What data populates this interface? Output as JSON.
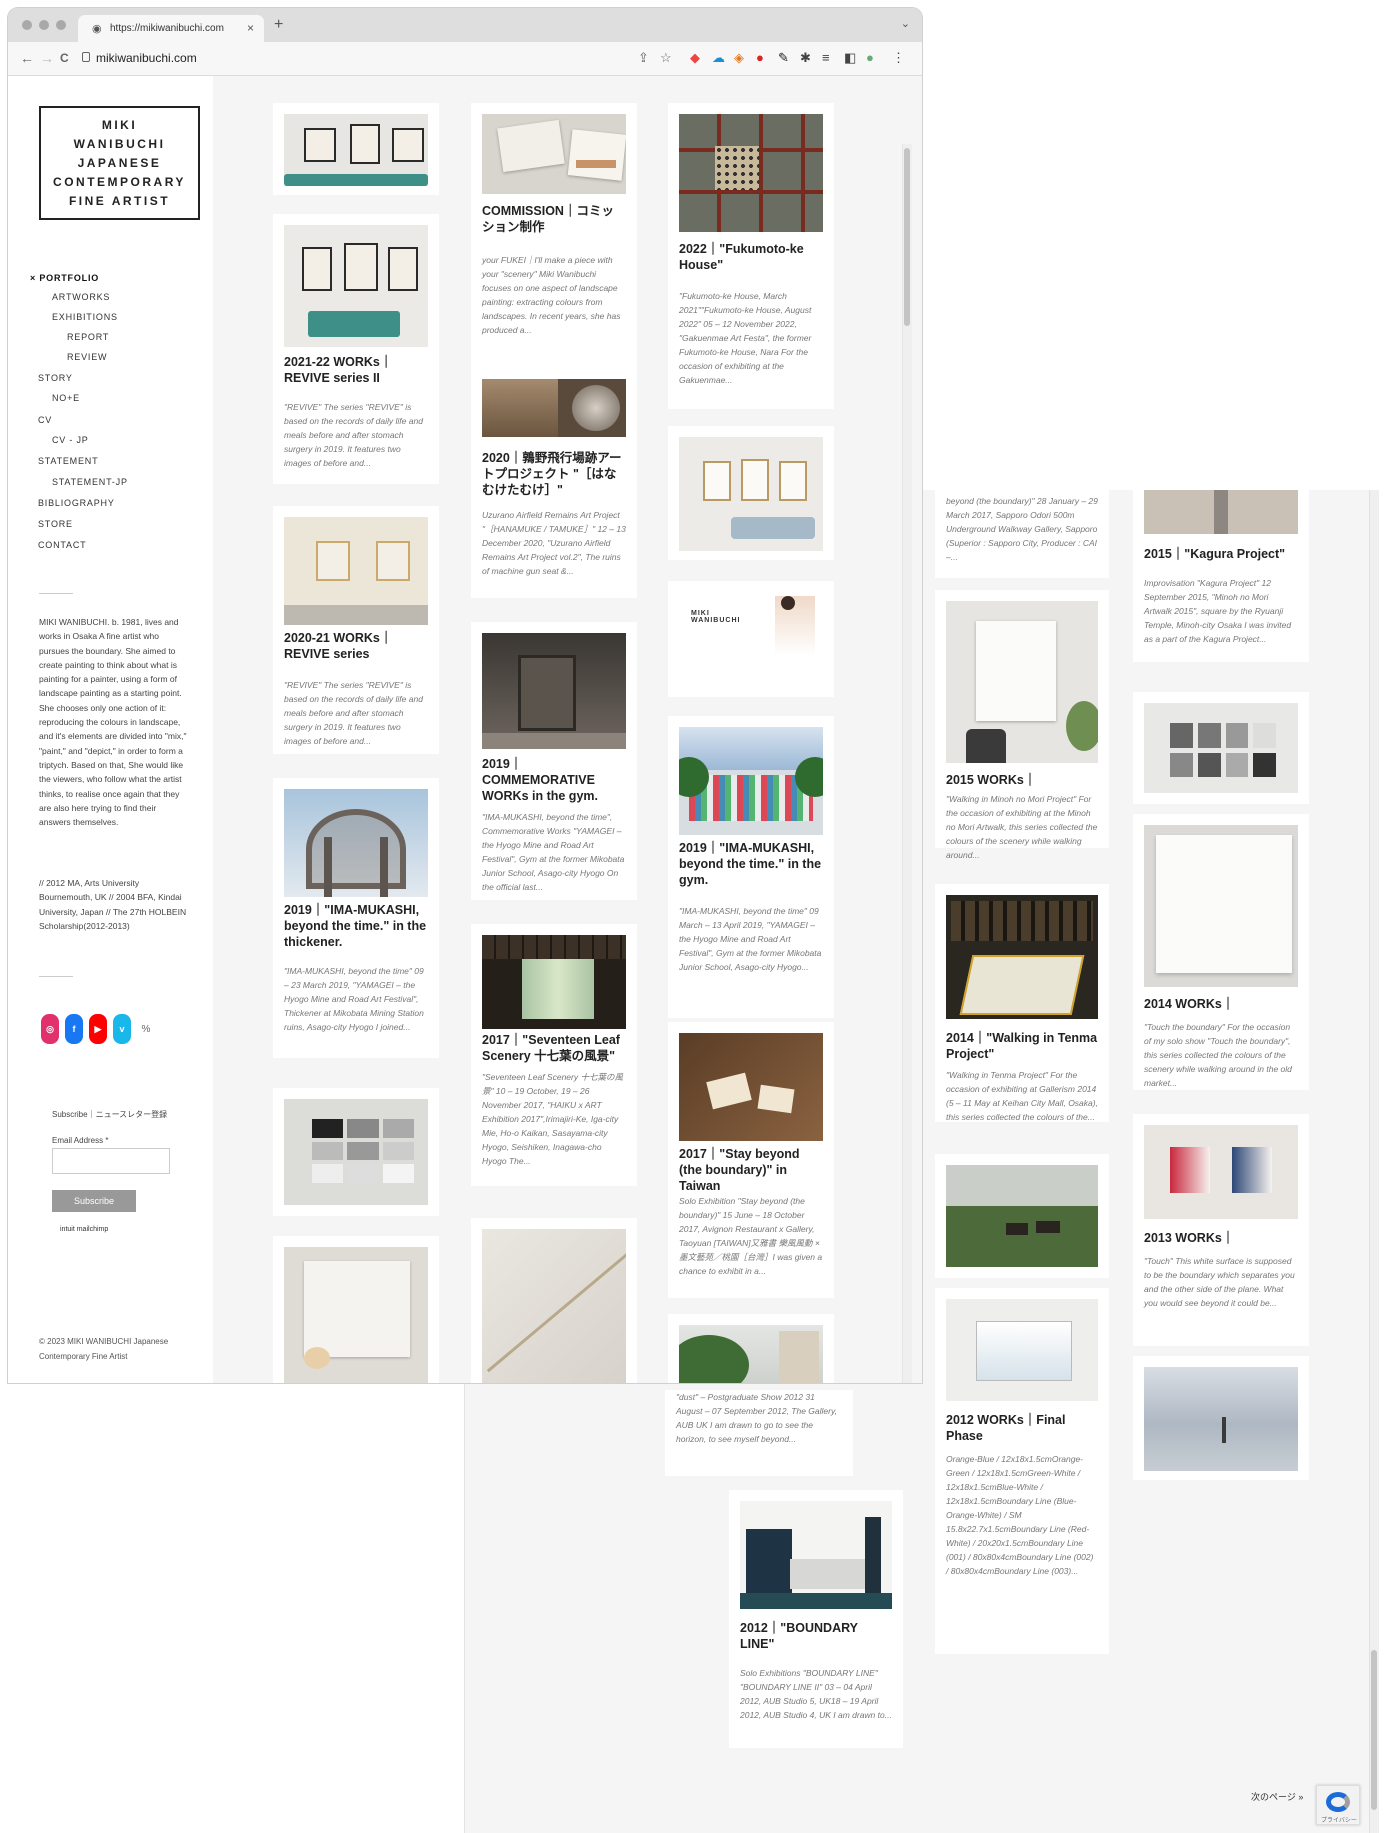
{
  "browser": {
    "tab_title": "https://mikiwanibuchi.com",
    "url": "mikiwanibuchi.com",
    "tab_close": "×",
    "new_tab": "+",
    "back": "←",
    "forward": "→",
    "reload": "C",
    "menu": "⋮"
  },
  "logo": {
    "line1": "MIKI",
    "line2": "WANIBUCHI",
    "line3": "JAPANESE",
    "line4": "CONTEMPORARY",
    "line5": "FINE ARTIST"
  },
  "menu": {
    "items": [
      "× PORTFOLIO",
      "ARTWORKS",
      "EXHIBITIONS",
      "REPORT",
      "REVIEW",
      "STORY",
      "NO+E",
      "CV",
      "CV - JP",
      "STATEMENT",
      "STATEMENT-JP",
      "BIBLIOGRAPHY",
      "STORE",
      "CONTACT"
    ]
  },
  "bio": {
    "text": "MIKI WANIBUCHI. b. 1981, lives and works in Osaka A fine artist who pursues the boundary. She aimed to create painting to think about what is painting for a painter, using a form of landscape painting as a starting point. She chooses only one action of it: reproducing the colours in landscape, and it's elements are divided into \"mix,\" \"paint,\" and \"depict,\" in order to form a triptych. Based on that, She would like the viewers, who follow what the artist thinks, to realise once again that they are also here trying to find their answers themselves.",
    "cv": "// 2012 MA, Arts University Bournemouth, UK // 2004 BFA, Kindai University, Japan // The 27th HOLBEIN Scholarship(2012-2013)"
  },
  "social": {
    "instagram": "◎",
    "facebook": "f",
    "youtube": "▶",
    "vimeo": "v",
    "link": "%"
  },
  "subscribe": {
    "label": "Subscribe｜ニュースレター登録",
    "email_label": "Email Address *",
    "email_value": "",
    "button": "Subscribe",
    "mailchimp": "intuit mailchimp"
  },
  "footer": {
    "copyright": "© 2023 MIKI WANIBUCHI Japanese Contemporary Fine Artist"
  },
  "cards": [
    {
      "title": "",
      "excerpt": ""
    },
    {
      "title": "2021-22 WORKs｜REVIVE series II",
      "excerpt": "\"REVIVE\" The series \"REVIVE\" is based on the records of daily life and meals before and after stomach surgery in 2019. It features two images of before and..."
    },
    {
      "title": "2020-21 WORKs｜REVIVE series",
      "excerpt": "\"REVIVE\" The series \"REVIVE\" is based on the records of daily life and meals before and after stomach surgery in 2019. It features two images of before and..."
    },
    {
      "title": "2019｜\"IMA-MUKASHI, beyond the time.\" in the thickener.",
      "excerpt": "\"IMA-MUKASHI, beyond the time\" 09 – 23 March 2019, \"YAMAGEI – the Hyogo Mine and Road Art Festival\", Thickener at Mikobata Mining Station ruins, Asago-city Hyogo I joined..."
    },
    {
      "title": "",
      "excerpt": ""
    },
    {
      "title": "",
      "excerpt": ""
    },
    {
      "title": "COMMISSION｜コミッション制作",
      "excerpt": "your FUKEI｜I'll make a piece with your \"scenery\" Miki Wanibuchi focuses on one aspect of landscape painting: extracting colours from landscapes. In recent years, she has produced a..."
    },
    {
      "title": "2020｜鶉野飛行場跡アートプロジェクト \"［はなむけたむけ］\"",
      "excerpt": "Uzurano Airfield Remains Art Project \"［HANAMUKE / TAMUKE］\" 12 – 13 December 2020, \"Uzurano Airfield Remains Art Project vol.2\", The ruins of machine gun seat &..."
    },
    {
      "title": "2019｜COMMEMORATIVE WORKs in the gym.",
      "excerpt": "\"IMA-MUKASHI, beyond the time\", Commemorative Works \"YAMAGEI – the Hyogo Mine and Road Art Festival\", Gym at the former Mikobata Junior School, Asago-city Hyogo On the official last..."
    },
    {
      "title": "2017｜\"Seventeen Leaf Scenery 十七葉の風景\"",
      "excerpt": "\"Seventeen Leaf Scenery 十七葉の風景\" 10 – 19 October, 19 – 26 November 2017, \"HAIKU x ART Exhibition 2017\",Irimajiri-Ke, Iga-city Mie, Ho-o Kaikan, Sasayama-city Hyogo, Seishiken, Inagawa-cho Hyogo The..."
    },
    {
      "title": "",
      "excerpt": ""
    },
    {
      "title": "2022｜\"Fukumoto-ke House\"",
      "excerpt": "\"Fukumoto-ke House, March 2021\"\"Fukumoto-ke House, August 2022\" 05 – 12 November 2022, \"Gakuenmae Art Festa\", the former Fukumoto-ke House, Nara For the occasion of exhibiting at the Gakuenmae..."
    },
    {
      "title": "",
      "excerpt": ""
    },
    {
      "title": "",
      "excerpt": ""
    },
    {
      "title": "2019｜\"IMA-MUKASHI, beyond the time.\" in the gym.",
      "excerpt": "\"IMA-MUKASHI, beyond the time\" 09 March – 13 April 2019, \"YAMAGEI – the Hyogo Mine and Road Art Festival\", Gym at the former Mikobata Junior School, Asago-city Hyogo..."
    },
    {
      "title": "2017｜\"Stay beyond (the boundary)\" in Taiwan",
      "excerpt": "Solo Exhibition \"Stay beyond (the boundary)\" 15 June – 18 October 2017, Avignon Restaurant x Gallery, Taoyuan [TAIWAN]又雅書 樂風風動 ×墨文藝苑／桃園［台灣］I was given a chance to exhibit in a..."
    },
    {
      "title": "",
      "excerpt": ""
    }
  ],
  "back_cards": [
    {
      "title": "",
      "excerpt": "\"dust\" – Postgraduate Show 2012 31 August – 07 September 2012, The Gallery, AUB UK I am drawn to go to see the horizon, to see myself beyond..."
    },
    {
      "title": "2012｜\"BOUNDARY LINE\"",
      "excerpt": "Solo Exhibitions \"BOUNDARY LINE\" \"BOUNDARY LINE II\" 03 – 04 April 2012, AUB Studio 5, UK18 – 19 April 2012, AUB Studio 4, UK I am drawn to..."
    },
    {
      "title": "",
      "excerpt": "beyond (the boundary)\" 28 January – 29 March 2017, Sapporo Odori 500m Underground Walkway Gallery, Sapporo (Superior : Sapporo City, Producer : CAI –..."
    },
    {
      "title": "2015 WORKs｜",
      "excerpt": "\"Walking in Minoh no Mori Project\" For the occasion of exhibiting at the Minoh no Mori Artwalk, this series collected the colours of the scenery while walking around..."
    },
    {
      "title": "2014｜\"Walking in Tenma Project\"",
      "excerpt": "\"Walking in Tenma Project\" For the occasion of exhibiting at Gallerism 2014 (5 – 11 May at Keihan City Mall, Osaka), this series collected the colours of the..."
    },
    {
      "title": "",
      "excerpt": ""
    },
    {
      "title": "2012 WORKs｜Final Phase",
      "excerpt": "Orange-Blue / 12x18x1.5cmOrange-Green / 12x18x1.5cmGreen-White / 12x18x1.5cmBlue-White / 12x18x1.5cmBoundary Line (Blue-Orange-White) / SM 15.8x22.7x1.5cmBoundary Line (Red-White) / 20x20x1.5cmBoundary Line (001) / 80x80x4cmBoundary Line (002) / 80x80x4cmBoundary Line (003)..."
    },
    {
      "title": "2015｜\"Kagura Project\"",
      "excerpt": "Improvisation \"Kagura Project\" 12 September 2015, \"Minoh no Mori Artwalk 2015\", square by the Ryuanji Temple, Minoh-city Osaka I was invited as a part of the Kagura Project..."
    },
    {
      "title": "",
      "excerpt": ""
    },
    {
      "title": "2014 WORKs｜",
      "excerpt": "\"Touch the boundary\" For the occasion of my solo show \"Touch the boundary\", this series collected the colours of the scenery while walking around in the old market..."
    },
    {
      "title": "2013 WORKs｜",
      "excerpt": "\"Touch\" This white surface is supposed to be the boundary which separates you and the other side of the plane. What you would see beyond it could be..."
    },
    {
      "title": "",
      "excerpt": ""
    }
  ],
  "pagination": {
    "next": "次のページ »"
  },
  "recaptcha": {
    "label": "プライバシー"
  },
  "colors": {
    "instagram": "#e1306c",
    "facebook": "#1877f2",
    "youtube": "#ff0000",
    "vimeo": "#1ab7ea",
    "sofa": "#3f8f89"
  }
}
